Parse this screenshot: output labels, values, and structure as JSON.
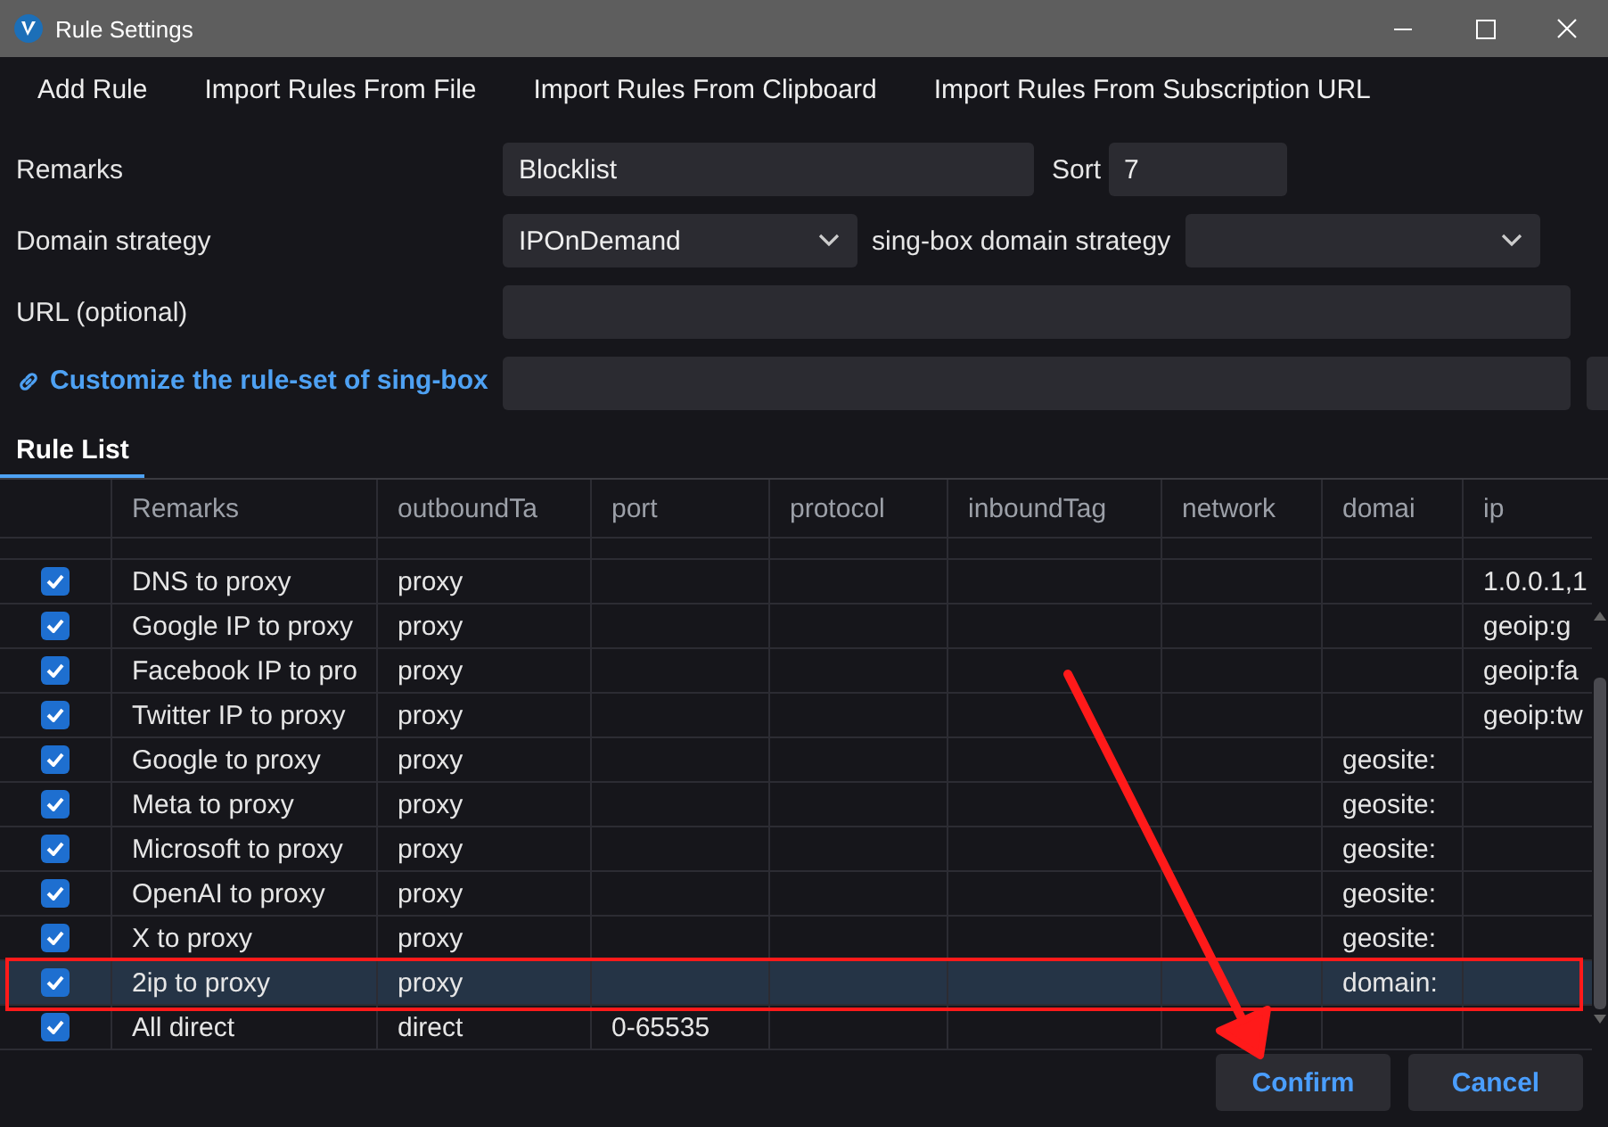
{
  "window": {
    "title": "Rule Settings"
  },
  "toolbar": [
    "Add Rule",
    "Import Rules From File",
    "Import Rules From Clipboard",
    "Import Rules From Subscription URL"
  ],
  "form": {
    "remarks_label": "Remarks",
    "remarks_value": "Blocklist",
    "sort_label": "Sort",
    "sort_value": "7",
    "domain_strategy_label": "Domain strategy",
    "domain_strategy_value": "IPOnDemand",
    "singbox_strategy_label": "sing-box domain strategy",
    "url_label": "URL (optional)",
    "ruleset_link": "Customize the rule-set of sing-box"
  },
  "tabs": [
    {
      "label": "Rule List",
      "selected": true
    }
  ],
  "table": {
    "columns": [
      "Remarks",
      "outboundTa",
      "port",
      "protocol",
      "inboundTag",
      "network",
      "domai",
      "ip"
    ],
    "rows": [
      {
        "enabled": true,
        "selected": false,
        "remarks": "DNS to proxy",
        "outbound_tag": "proxy",
        "ip": "1.0.0.1,1"
      },
      {
        "enabled": true,
        "selected": false,
        "remarks": "Google IP to proxy",
        "outbound_tag": "proxy",
        "ip": "geoip:g"
      },
      {
        "enabled": true,
        "selected": false,
        "remarks": "Facebook IP to pro",
        "outbound_tag": "proxy",
        "ip": "geoip:fa"
      },
      {
        "enabled": true,
        "selected": false,
        "remarks": "Twitter IP to proxy",
        "outbound_tag": "proxy",
        "ip": "geoip:tw"
      },
      {
        "enabled": true,
        "selected": false,
        "remarks": "Google to proxy",
        "outbound_tag": "proxy",
        "domain": "geosite:"
      },
      {
        "enabled": true,
        "selected": false,
        "remarks": "Meta to proxy",
        "outbound_tag": "proxy",
        "domain": "geosite:"
      },
      {
        "enabled": true,
        "selected": false,
        "remarks": "Microsoft to proxy",
        "outbound_tag": "proxy",
        "domain": "geosite:"
      },
      {
        "enabled": true,
        "selected": false,
        "remarks": "OpenAI to proxy",
        "outbound_tag": "proxy",
        "domain": "geosite:"
      },
      {
        "enabled": true,
        "selected": false,
        "remarks": "X to proxy",
        "outbound_tag": "proxy",
        "domain": "geosite:"
      },
      {
        "enabled": true,
        "selected": true,
        "remarks": "2ip to proxy",
        "outbound_tag": "proxy",
        "domain": "domain:"
      },
      {
        "enabled": true,
        "selected": false,
        "remarks": "All direct",
        "outbound_tag": "direct",
        "port": "0-65535"
      }
    ]
  },
  "buttons": [
    "Confirm",
    "Cancel"
  ]
}
